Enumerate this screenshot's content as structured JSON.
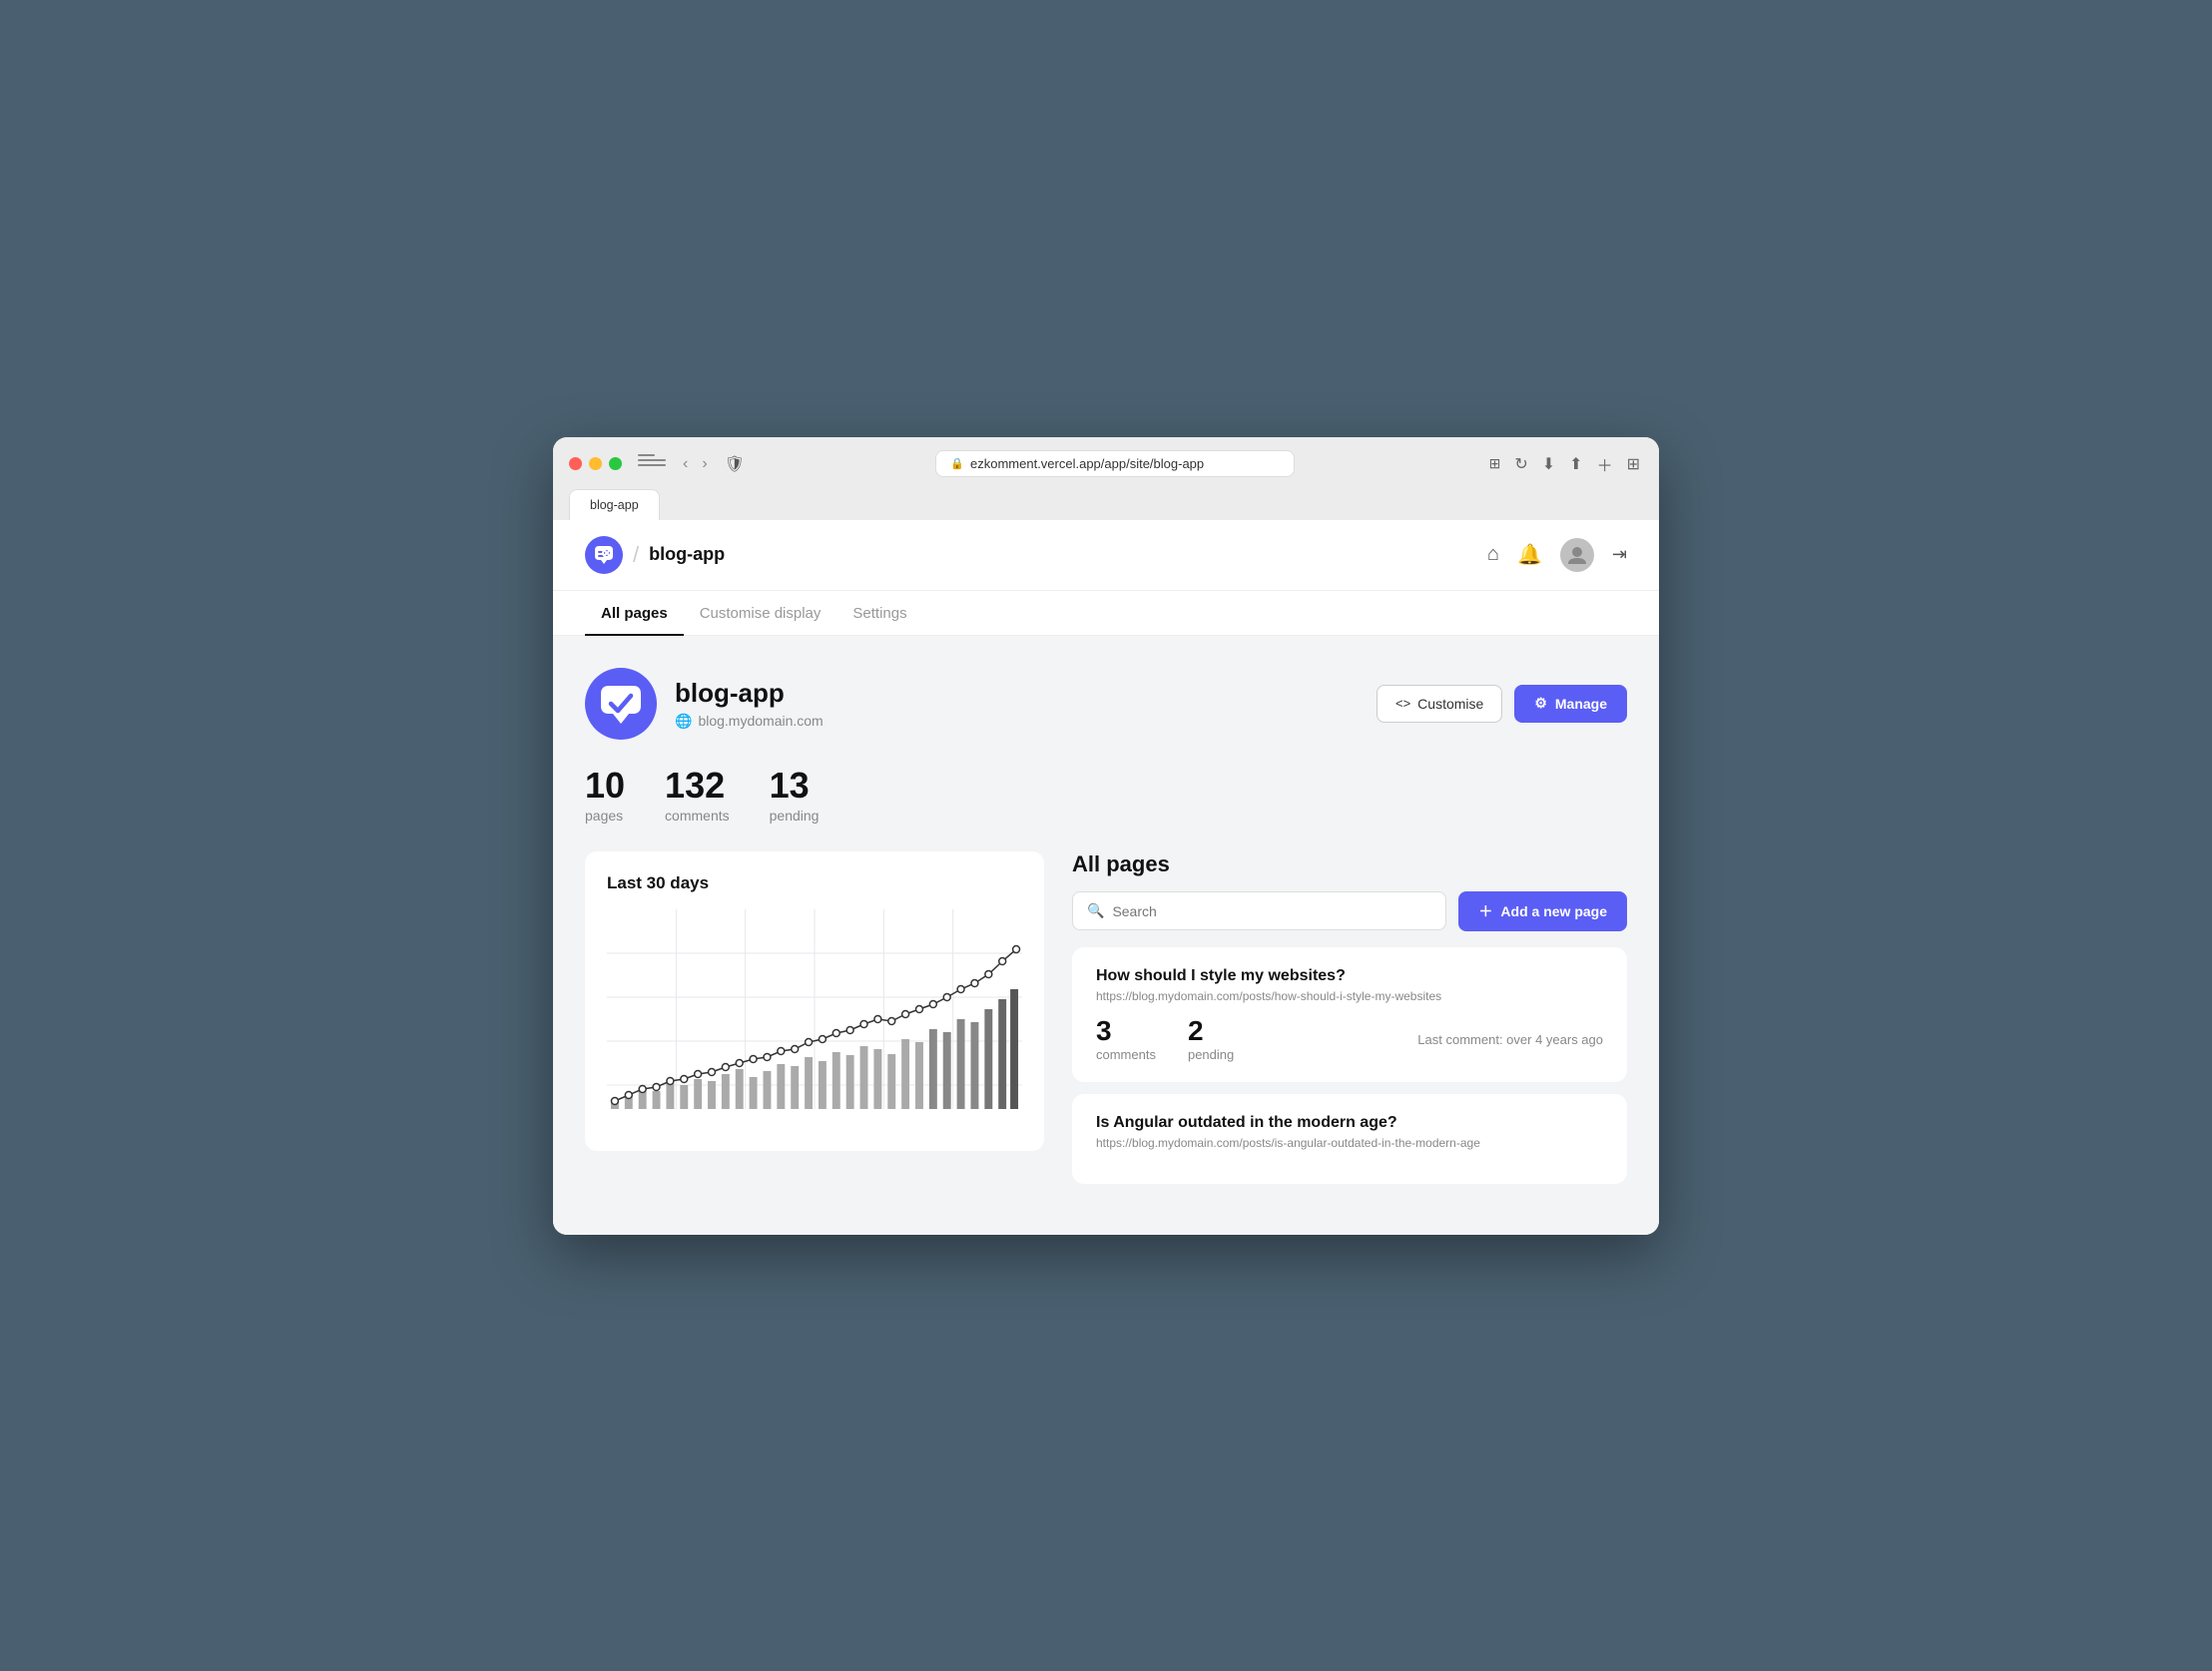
{
  "browser": {
    "url": "ezkomment.vercel.app/app/site/blog-app",
    "tab_label": "blog-app"
  },
  "header": {
    "app_name": "blog-app",
    "nav_home_icon": "⌂",
    "nav_bell_icon": "🔔",
    "nav_logout_icon": "→"
  },
  "nav_tabs": [
    {
      "id": "all-pages",
      "label": "All pages",
      "active": true
    },
    {
      "id": "customise",
      "label": "Customise display",
      "active": false
    },
    {
      "id": "settings",
      "label": "Settings",
      "active": false
    }
  ],
  "site": {
    "name": "blog-app",
    "domain": "blog.mydomain.com",
    "stats": {
      "pages": {
        "value": "10",
        "label": "pages"
      },
      "comments": {
        "value": "132",
        "label": "comments"
      },
      "pending": {
        "value": "13",
        "label": "pending"
      }
    }
  },
  "buttons": {
    "customise": "Customise",
    "manage": "Manage",
    "add_page": "+ Add a new page"
  },
  "chart": {
    "title": "Last 30 days",
    "bars": [
      2,
      3,
      5,
      4,
      6,
      5,
      7,
      6,
      8,
      9,
      7,
      8,
      10,
      9,
      11,
      10,
      12,
      11,
      13,
      12,
      11,
      14,
      13,
      15,
      14,
      16,
      15,
      17,
      18,
      19
    ],
    "line": [
      1,
      2,
      3,
      3,
      4,
      4,
      5,
      5,
      6,
      6,
      7,
      7,
      8,
      8,
      9,
      9,
      10,
      10,
      11,
      12,
      12,
      13,
      13,
      14,
      15,
      15,
      16,
      17,
      18,
      20
    ]
  },
  "pages": {
    "title": "All pages",
    "search_placeholder": "Search",
    "items": [
      {
        "id": "page-1",
        "title": "How should I style my websites?",
        "url": "https://blog.mydomain.com/posts/how-should-i-style-my-websites",
        "comments": "3",
        "pending": "2",
        "last_comment": "Last comment: over 4 years ago"
      },
      {
        "id": "page-2",
        "title": "Is Angular outdated in the modern age?",
        "url": "https://blog.mydomain.com/posts/is-angular-outdated-in-the-modern-age",
        "comments": "",
        "pending": "",
        "last_comment": ""
      }
    ]
  },
  "colors": {
    "accent": "#5b5ef4",
    "text_primary": "#111111",
    "text_muted": "#888888",
    "border": "#e5e7eb"
  }
}
